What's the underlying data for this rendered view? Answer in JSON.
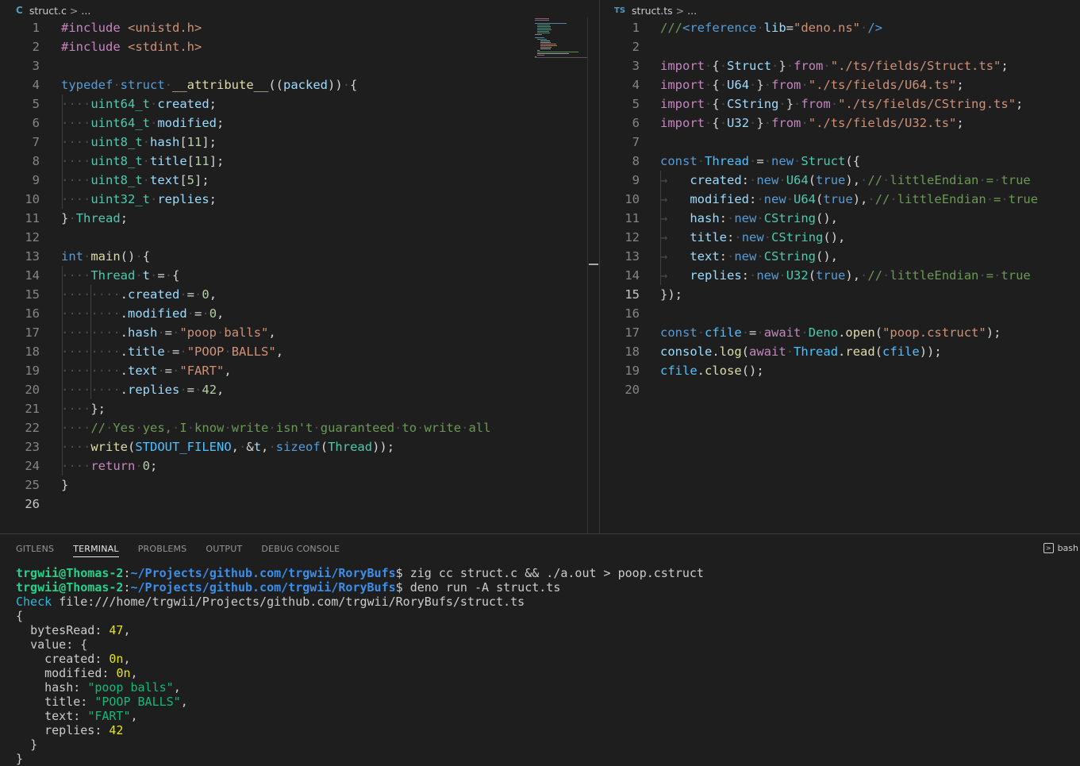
{
  "left_editor": {
    "file_icon": "C",
    "filename": "struct.c",
    "breadcrumb_sep": ">",
    "breadcrumb_more": "...",
    "lines": [
      "#include <unistd.h>",
      "#include <stdint.h>",
      "",
      "typedef struct __attribute__((packed)) {",
      "uint64_t created;",
      "uint64_t modified;",
      "uint8_t hash[11];",
      "uint8_t title[11];",
      "uint8_t text[5];",
      "uint32_t replies;",
      "} Thread;",
      "",
      "int main() {",
      "Thread t = {",
      ".created = 0,",
      ".modified = 0,",
      ".hash = \"poop balls\",",
      ".title = \"POOP BALLS\",",
      ".text = \"FART\",",
      ".replies = 42,",
      "};",
      "// Yes yes, I know write isn't guaranteed to write all",
      "write(STDOUT_FILENO, &t, sizeof(Thread));",
      "return 0;",
      "}",
      ""
    ],
    "line_numbers": [
      "1",
      "2",
      "3",
      "4",
      "5",
      "6",
      "7",
      "8",
      "9",
      "10",
      "11",
      "12",
      "13",
      "14",
      "15",
      "16",
      "17",
      "18",
      "19",
      "20",
      "21",
      "22",
      "23",
      "24",
      "25",
      "26"
    ],
    "active_line": "26"
  },
  "right_editor": {
    "file_icon": "TS",
    "filename": "struct.ts",
    "breadcrumb_sep": ">",
    "breadcrumb_more": "...",
    "lines": [
      "///<reference lib=\"deno.ns\" />",
      "",
      "import { Struct } from \"./ts/fields/Struct.ts\";",
      "import { U64 } from \"./ts/fields/U64.ts\";",
      "import { CString } from \"./ts/fields/CString.ts\";",
      "import { U32 } from \"./ts/fields/U32.ts\";",
      "",
      "const Thread = new Struct({",
      "created: new U64(true), // littleEndian = true",
      "modified: new U64(true), // littleEndian = true",
      "hash: new CString(),",
      "title: new CString(),",
      "text: new CString(),",
      "replies: new U32(true), // littleEndian = true",
      "});",
      "",
      "const cfile = await Deno.open(\"poop.cstruct\");",
      "console.log(await Thread.read(cfile));",
      "cfile.close();",
      ""
    ],
    "line_numbers": [
      "1",
      "2",
      "3",
      "4",
      "5",
      "6",
      "7",
      "8",
      "9",
      "10",
      "11",
      "12",
      "13",
      "14",
      "15",
      "16",
      "17",
      "18",
      "19",
      "20"
    ],
    "active_line": "15"
  },
  "panel": {
    "tabs": [
      "GITLENS",
      "TERMINAL",
      "PROBLEMS",
      "OUTPUT",
      "DEBUG CONSOLE"
    ],
    "active_tab": "TERMINAL",
    "shell": "bash",
    "shell_icon": "terminal-icon"
  },
  "terminal": {
    "prompt_user": "trgwii@Thomas-2",
    "prompt_path": "~/Projects/github.com/trgwii/RoryBufs",
    "commands": [
      "zig cc struct.c && ./a.out > poop.cstruct",
      "deno run -A struct.ts"
    ],
    "check_label": "Check",
    "check_path": "file:///home/trgwii/Projects/github.com/trgwii/RoryBufs/struct.ts",
    "output": {
      "open": "{",
      "bytes_read_key": "bytesRead",
      "bytes_read": "47",
      "value_key": "value",
      "value_open": "{",
      "fields": [
        {
          "key": "created",
          "value": "0n",
          "kind": "bigint"
        },
        {
          "key": "modified",
          "value": "0n",
          "kind": "bigint"
        },
        {
          "key": "hash",
          "value": "\"poop balls\"",
          "kind": "string"
        },
        {
          "key": "title",
          "value": "\"POOP BALLS\"",
          "kind": "string"
        },
        {
          "key": "text",
          "value": "\"FART\"",
          "kind": "string"
        },
        {
          "key": "replies",
          "value": "42",
          "kind": "number"
        }
      ],
      "value_close": "}",
      "close": "}"
    }
  },
  "colors": {
    "editor_bg": "#1e1e1e",
    "keyword": "#569cd6",
    "control": "#c586c0",
    "type": "#4ec9b0",
    "string": "#ce9178",
    "number": "#b5cea8",
    "comment": "#6a9955",
    "prompt_user": "#23d18b",
    "prompt_path": "#3b8eea"
  }
}
